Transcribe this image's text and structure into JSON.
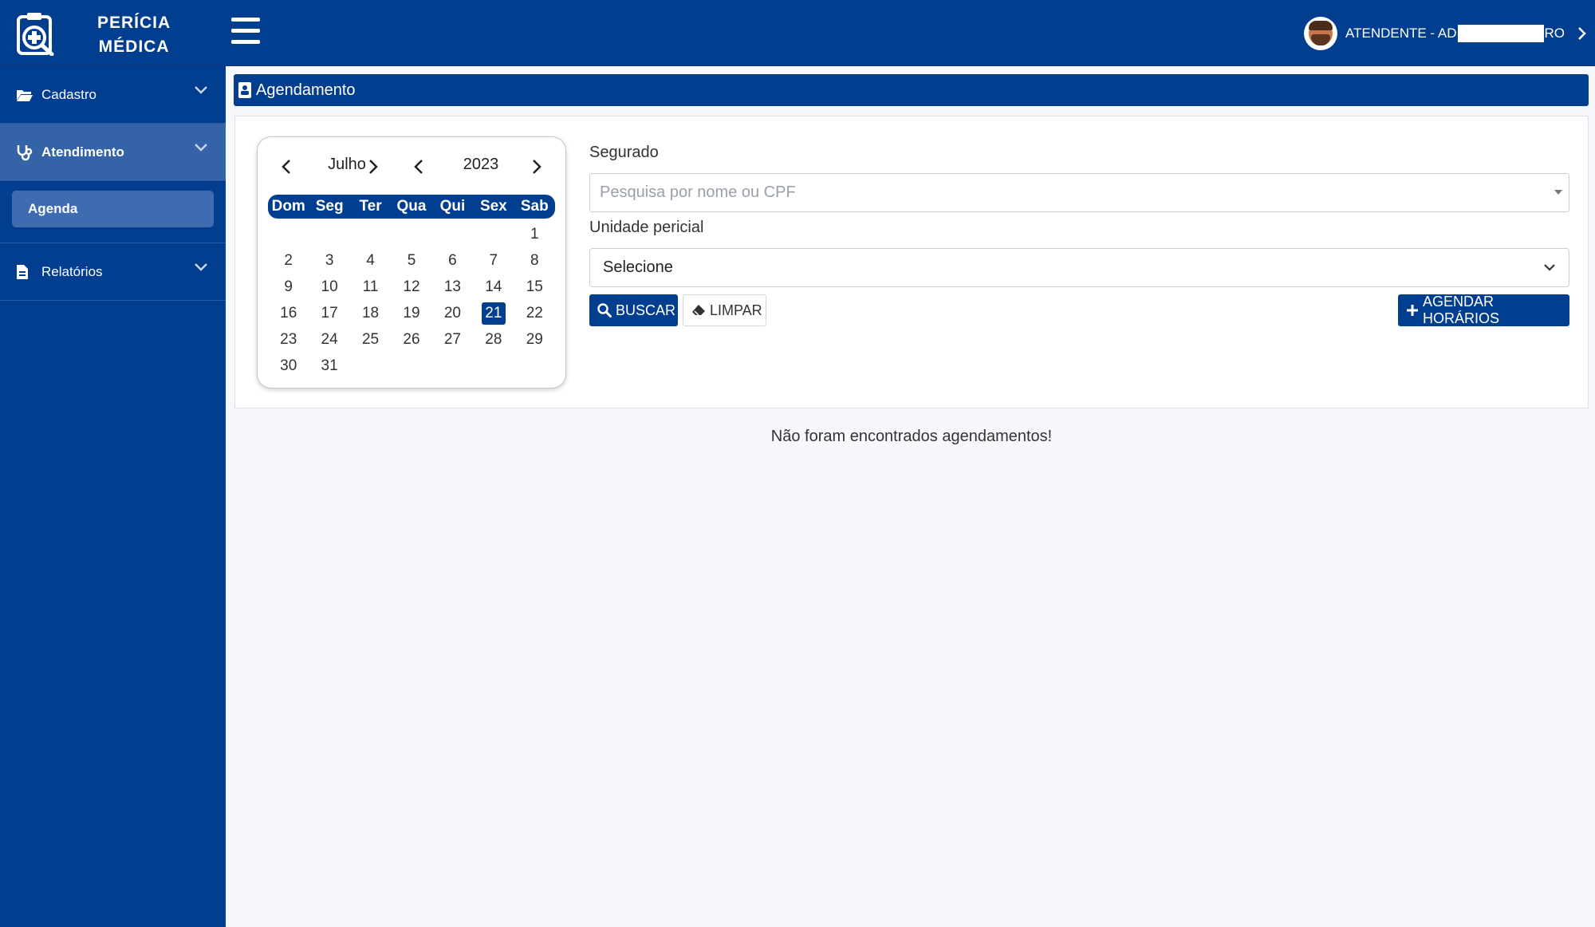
{
  "brand": {
    "line1": "PERÍCIA",
    "line2": "MÉDICA"
  },
  "user": {
    "prefix": "ATENDENTE - AD",
    "suffix": "RO"
  },
  "sidebar": {
    "items": [
      {
        "label": "Cadastro"
      },
      {
        "label": "Atendimento"
      },
      {
        "label": "Relatórios"
      }
    ],
    "sub_item": "Agenda"
  },
  "section": {
    "title": "Agendamento"
  },
  "calendar": {
    "month": "Julho",
    "year": "2023",
    "weekdays": [
      "Dom",
      "Seg",
      "Ter",
      "Qua",
      "Qui",
      "Sex",
      "Sab"
    ],
    "first_weekday_index": 6,
    "days_in_month": 31,
    "selected_day": 21
  },
  "form": {
    "segurado_label": "Segurado",
    "segurado_placeholder": "Pesquisa por nome ou CPF",
    "unidade_label": "Unidade pericial",
    "unidade_value": "Selecione",
    "buscar": "BUSCAR",
    "limpar": "LIMPAR",
    "agendar": "AGENDAR HORÁRIOS"
  },
  "empty_message": "Não foram encontrados agendamentos!",
  "colors": {
    "primary": "#023e8f",
    "sidebar_active": "#3563a8"
  }
}
